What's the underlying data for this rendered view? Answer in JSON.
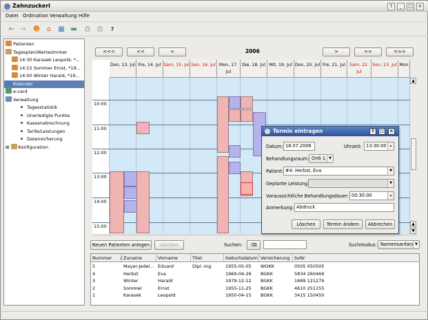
{
  "window": {
    "title": "Zahnzuckerl",
    "buttons": [
      "?",
      "_",
      "□",
      "×"
    ]
  },
  "menu": [
    "Datei",
    "Ordination",
    "Verwaltung",
    "Hilfe"
  ],
  "toolbar": {
    "help_label": "?"
  },
  "tree": [
    {
      "label": "Patienten",
      "indent": 0,
      "icon": "patients-icon",
      "color": "#d88a3a"
    },
    {
      "label": "Tagesplan/Wartezimmer",
      "indent": 0,
      "icon": "waiting-room-icon",
      "color": "#c8a060"
    },
    {
      "label": "14:30 Karasek Leopold, *...",
      "indent": 1,
      "icon": "person-icon",
      "color": "#d88a3a"
    },
    {
      "label": "14:15 Sommer Ernst, *19...",
      "indent": 1,
      "icon": "person-icon",
      "color": "#d88a3a"
    },
    {
      "label": "14:00 Winter Harald, *19...",
      "indent": 1,
      "icon": "person-icon",
      "color": "#d88a3a"
    },
    {
      "label": "Kalender",
      "indent": 0,
      "icon": "calendar-icon",
      "color": "#4f78b8",
      "selected": true
    },
    {
      "label": "e-card",
      "indent": 0,
      "icon": "ecard-icon",
      "color": "#4aa060"
    },
    {
      "label": "Verwaltung",
      "indent": 0,
      "icon": "admin-icon",
      "color": "#6a8ec0"
    },
    {
      "label": "Tagesstatistik",
      "indent": 2,
      "bullet": true
    },
    {
      "label": "Unerledigte Punkte",
      "indent": 2,
      "bullet": true
    },
    {
      "label": "Kassenabrechnung",
      "indent": 2,
      "bullet": true
    },
    {
      "label": "Tarife/Leistungen",
      "indent": 2,
      "bullet": true
    },
    {
      "label": "Datensicherung",
      "indent": 2,
      "bullet": true
    },
    {
      "label": "Konfiguration",
      "indent": 0,
      "icon": "config-icon",
      "color": "#c8a060",
      "expander": "⊞"
    }
  ],
  "calendar": {
    "nav": [
      "<<<",
      "<<",
      "<",
      ">",
      ">>",
      ">>>"
    ],
    "year": "2006",
    "days": [
      {
        "label": "Don, 13. Jul",
        "red": false
      },
      {
        "label": "Fre, 14. Jul",
        "red": false
      },
      {
        "label": "Sam, 15. Jul",
        "red": true
      },
      {
        "label": "Son, 16. Jul",
        "red": true
      },
      {
        "label": "Mon, 17. Jul",
        "red": false
      },
      {
        "label": "Die, 18. Jul",
        "red": false
      },
      {
        "label": "Mit, 19. Jul",
        "red": false
      },
      {
        "label": "Don, 20. Jul",
        "red": false
      },
      {
        "label": "Fre, 21. Jul",
        "red": false
      },
      {
        "label": "Sam, 22. Jul",
        "red": true
      },
      {
        "label": "Son, 23. Jul",
        "red": true
      },
      {
        "label": "Mon",
        "red": false
      }
    ],
    "times": [
      "10:00",
      "11:00",
      "12:00",
      "13:00",
      "14:00",
      "15:00"
    ]
  },
  "buttons": {
    "new_patient": "Neuen Patienten anlegen",
    "delete": "Löschen",
    "search_label": "Suchen:",
    "search_value": "",
    "search_mode_label": "Suchmodus:",
    "search_mode": "Namensanfang"
  },
  "table": {
    "columns": [
      "Nummer",
      "Zuname",
      "Vorname",
      "Titel",
      "Geburtsdatum",
      "Versicherung",
      "SvNr"
    ],
    "sort_indicator": "/",
    "rows": [
      [
        "5",
        "Mayer-Jedel...",
        "Eduard",
        "Dipl.-Ing",
        "1955-05-05",
        "WGKK",
        "0505 050505"
      ],
      [
        "4",
        "Herbst",
        "Eva",
        "",
        "1969-04-26",
        "BGKK",
        "5834 260469"
      ],
      [
        "3",
        "Winter",
        "Harald",
        "",
        "1979-12-12",
        "BGKK",
        "1689 121279"
      ],
      [
        "2",
        "Sommer",
        "Ernst",
        "",
        "1955-11-25",
        "BGKK",
        "4610 251155"
      ],
      [
        "1",
        "Karasek",
        "Leopold",
        "",
        "1950-04-15",
        "BGKK",
        "3415 150450"
      ]
    ]
  },
  "dialog": {
    "title": "Termin eintragen",
    "datum_label": "Datum:",
    "datum": "18.07.2006",
    "uhrzeit_label": "Uhrzeit:",
    "uhrzeit": "13:30:00",
    "raum_label": "Behandlungsraum:",
    "raum": "Ordi 1",
    "patient_label": "Patient:",
    "patient": "#4: Herbst,  Eva",
    "leistung_label": "Geplante Leistung:",
    "leistung": "",
    "dauer_label": "Voraussichtliche Behandlungsdauer:",
    "dauer": "00:30:00",
    "anmerkung_label": "Anmerkung:",
    "anmerkung": "Abdruck",
    "delete": "Löschen",
    "change": "Termin ändern",
    "cancel": "Abbrechen"
  }
}
